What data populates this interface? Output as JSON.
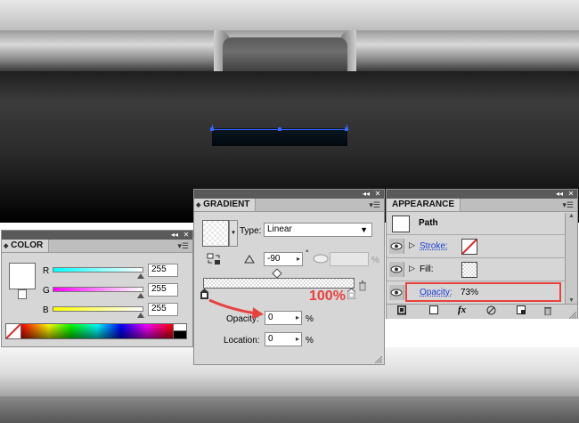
{
  "colors": {
    "panel_bg": "#d6d6d6",
    "titlebar": "#5a5a5a",
    "selection": "#3a64ff",
    "annotation_red": "#e8423f",
    "link_blue": "#1a3fd6"
  },
  "color_panel": {
    "tab_label": "COLOR",
    "channels": [
      {
        "label": "R",
        "value": "255"
      },
      {
        "label": "G",
        "value": "255"
      },
      {
        "label": "B",
        "value": "255"
      }
    ]
  },
  "gradient_panel": {
    "tab_label": "GRADIENT",
    "type_label": "Type:",
    "type_value": "Linear",
    "angle_value": "-90",
    "degree_symbol": "°",
    "aspect_unit": "%",
    "opacity_label": "Opacity:",
    "opacity_value": "0",
    "opacity_unit": "%",
    "location_label": "Location:",
    "location_value": "0",
    "location_unit": "%"
  },
  "appearance_panel": {
    "tab_label": "APPEARANCE",
    "path_label": "Path",
    "rows": [
      {
        "label": "Stroke:"
      },
      {
        "label": "Fill:"
      },
      {
        "label": "Opacity:",
        "value": "73%"
      }
    ]
  },
  "annotation": {
    "text": "100%"
  }
}
